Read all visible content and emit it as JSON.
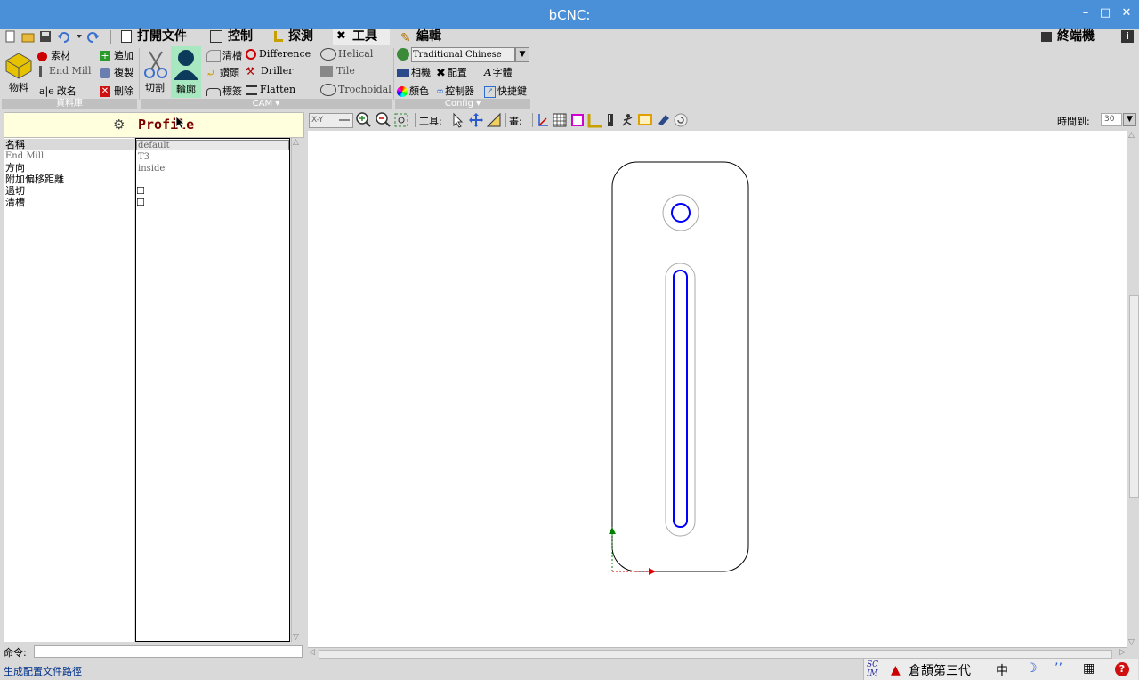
{
  "window": {
    "title": "bCNC:"
  },
  "menu": {
    "tabs": [
      {
        "label": "打開文件"
      },
      {
        "label": "控制"
      },
      {
        "label": "探測"
      },
      {
        "label": "工具"
      },
      {
        "label": "編輯"
      }
    ],
    "terminal_label": "終端機"
  },
  "ribbon": {
    "database": {
      "big_label": "物料",
      "items": [
        "素材",
        "End Mill",
        "改名",
        "追加",
        "複製",
        "刪除"
      ],
      "group_label": "資料庫"
    },
    "cam": {
      "cut_label": "切割",
      "profile_label": "輪廓",
      "items": [
        "清槽",
        "Difference",
        "Helical",
        "鑽頭",
        "Driller",
        "Tile",
        "標簽",
        "Flatten",
        "Trochoidal"
      ],
      "group_label": "CAM"
    },
    "config": {
      "language": "Traditional Chinese",
      "items": [
        "相機",
        "配置",
        "字體",
        "顏色",
        "控制器",
        "快捷鍵"
      ],
      "group_label": "Config"
    }
  },
  "panel": {
    "title": "Profile",
    "properties": [
      {
        "name": "名稱",
        "value": "default"
      },
      {
        "name": "End Mill",
        "value": "T3"
      },
      {
        "name": "方向",
        "value": "inside"
      },
      {
        "name": "附加偏移距離",
        "value": ""
      },
      {
        "name": "過切",
        "value": "☐"
      },
      {
        "name": "清槽",
        "value": "☐"
      }
    ]
  },
  "command": {
    "label": "命令:",
    "value": ""
  },
  "status": {
    "text": "生成配置文件路徑"
  },
  "toolbar2": {
    "view": "X-Y",
    "tools_label": "工具:",
    "draw_label": "畫:",
    "time_label": "時間到:",
    "time_value": "30"
  },
  "ime": {
    "brand": "SCIM",
    "input_method": "倉頡第三代",
    "mode": "中"
  }
}
